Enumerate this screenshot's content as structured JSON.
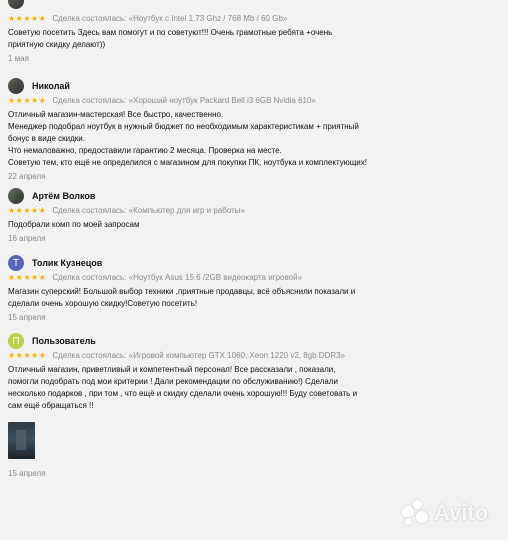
{
  "reviews": [
    {
      "name": "",
      "stars": "★★★★★",
      "deal": "Сделка состоялась: «Ноутбук с Intel 1.73 Ghz / 768 Mb / 60 Gb»",
      "lines": [
        "Советую посетить Здесь вам помогут и по советуют!!! Очень грамотные ребята +очень",
        "приятную скидку делают))"
      ],
      "date": "1 мая"
    },
    {
      "name": "Николай",
      "stars": "★★★★★",
      "deal": "Сделка состоялась: «Хороший ноутбук Packard Bell i3 6GB Nvidia 610»",
      "lines": [
        "Отличный магазин-мастерская! Все быстро, качественно.",
        "Менеджер подобрал ноутбук в нужный бюджет по необходимым характеристикам + приятный",
        "бонус в виде скидки.",
        "Что немаловажно, предоставили гарантию 2 месяца. Проверка на месте.",
        "Советую тем, кто ещё не определился с магазином для покупки ПК, ноутбука и комплектующих!"
      ],
      "date": "22 апреля"
    },
    {
      "name": "Артём Волков",
      "stars": "★★★★★",
      "deal": "Сделка состоялась: «Компьютер для игр и работы»",
      "lines": [
        "Подобрали комп по моей запросам"
      ],
      "date": "16 апреля"
    },
    {
      "name": "Толик Кузнецов",
      "avatar_letter": "Т",
      "stars": "★★★★★",
      "deal": "Сделка состоялась: «Ноутбук Asus 15.6 /2GB видеокарта игровой»",
      "lines": [
        "Магазин суперский! Большой выбор техники ,приятные продавцы, всё объяснили показали и",
        "сделали очень хорошую скидку!Советую посетить!"
      ],
      "date": "15 апреля"
    },
    {
      "name": "Пользователь",
      "avatar_letter": "П",
      "stars": "★★★★★",
      "deal": "Сделка состоялась: «Игровой компьютер GTX 1060, Xeon 1220 v2, 8gb DDR3»",
      "lines": [
        "Отличный магазин, приветливый и компетентный персонал! Все рассказали , показали,",
        "помогли подобрать под мои критерии ! Дали рекомендации по обслуживанию!) Сделали",
        "несколько подарков , при том , что ещё и скидку сделали очень хорошую!!! Буду советовать и",
        "сам ещё обращаться !!"
      ],
      "date": "15 апреля"
    }
  ],
  "watermark": "Avito"
}
